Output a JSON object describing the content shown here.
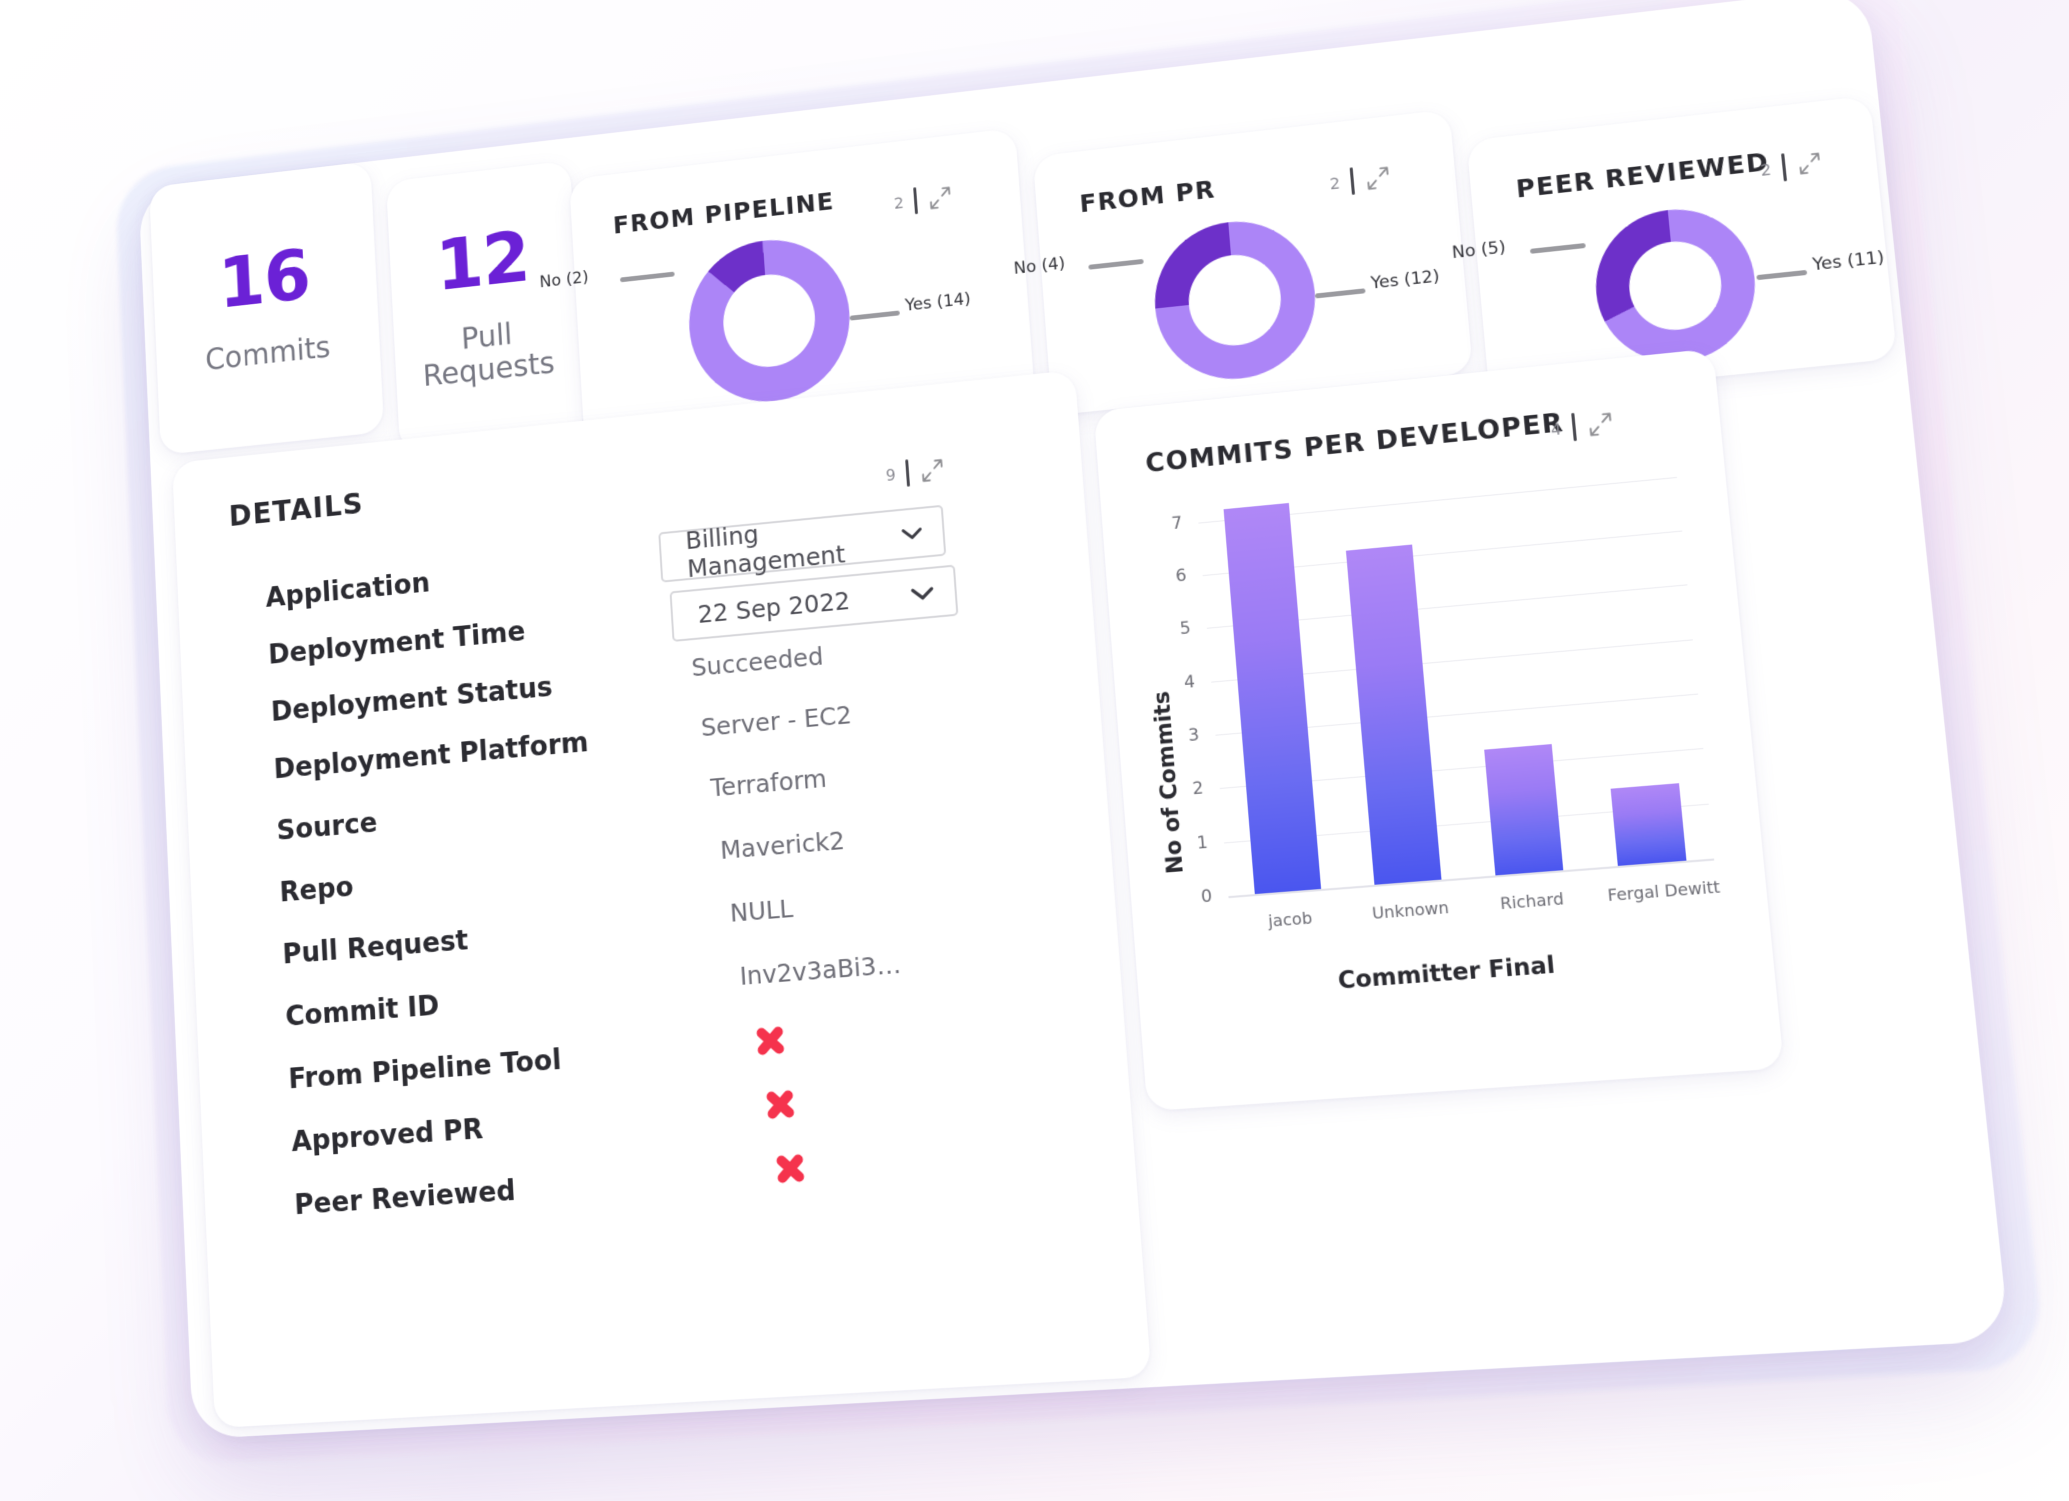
{
  "kpis": [
    {
      "name": "commits",
      "value": "16",
      "label": "Commits"
    },
    {
      "name": "pull-requests",
      "value": "12",
      "label": "Pull\nRequests"
    }
  ],
  "donut_cards": [
    {
      "id": "pipeline",
      "title": "FROM PIPELINE",
      "badge": "2",
      "chart_data": {
        "type": "pie",
        "title": "FROM PIPELINE",
        "categories": [
          "Yes",
          "No"
        ],
        "values": [
          14,
          2
        ],
        "labels": [
          "Yes (14)",
          "No (2)"
        ],
        "colors": [
          "#ac85f7",
          "#6d30c9"
        ],
        "legend": "callout-leader-lines"
      }
    },
    {
      "id": "pr",
      "title": "FROM PR",
      "badge": "2",
      "chart_data": {
        "type": "pie",
        "title": "FROM PR",
        "categories": [
          "Yes",
          "No"
        ],
        "values": [
          12,
          4
        ],
        "labels": [
          "Yes (12)",
          "No (4)"
        ],
        "colors": [
          "#ac85f7",
          "#6d30c9"
        ],
        "legend": "callout-leader-lines"
      }
    },
    {
      "id": "peer",
      "title": "PEER REVIEWED",
      "badge": "2",
      "chart_data": {
        "type": "pie",
        "title": "PEER REVIEWED",
        "categories": [
          "Yes",
          "No"
        ],
        "values": [
          11,
          5
        ],
        "labels": [
          "Yes (11)",
          "No (5)"
        ],
        "colors": [
          "#ac85f7",
          "#6d30c9"
        ],
        "legend": "callout-leader-lines"
      }
    }
  ],
  "details": {
    "title": "DETAILS",
    "badge": "9",
    "rows": [
      {
        "label": "Application",
        "value": "Billing Management",
        "kind": "dropdown"
      },
      {
        "label": "Deployment Time",
        "value": "22 Sep 2022",
        "kind": "dropdown"
      },
      {
        "label": "Deployment Status",
        "value": "Succeeded",
        "kind": "text"
      },
      {
        "label": "Deployment Platform",
        "value": "Server - EC2",
        "kind": "text"
      },
      {
        "label": "Source",
        "value": "Terraform",
        "kind": "text"
      },
      {
        "label": "Repo",
        "value": "Maverick2",
        "kind": "text"
      },
      {
        "label": "Pull Request",
        "value": "NULL",
        "kind": "text"
      },
      {
        "label": "Commit ID",
        "value": "Inv2v3aBi3…",
        "kind": "text"
      },
      {
        "label": "From Pipeline Tool",
        "value": "x-mark",
        "kind": "icon"
      },
      {
        "label": "Approved PR",
        "value": "x-mark",
        "kind": "icon"
      },
      {
        "label": "Peer Reviewed",
        "value": "x-mark",
        "kind": "icon"
      }
    ]
  },
  "bar_card": {
    "title": "COMMITS PER DEVELOPER",
    "badge": "4"
  },
  "chart_data": {
    "type": "bar",
    "title": "COMMITS PER DEVELOPER",
    "categories": [
      "jacob",
      "Unknown",
      "Richard",
      "Fergal Dewitt"
    ],
    "values": [
      7.2,
      6.2,
      2.3,
      1.4
    ],
    "xlabel": "Committer Final",
    "ylabel": "No of Commits",
    "yticks": [
      "0",
      "1",
      "2",
      "3",
      "4",
      "5",
      "6",
      "7"
    ],
    "ylim": [
      0,
      7.5
    ],
    "grid": true,
    "legend": "none"
  },
  "colors": {
    "accent": "#6B21D6",
    "donut_light": "#ac85f7",
    "donut_dark": "#6d30c9",
    "bar_top": "#b088f7",
    "bar_bottom": "#4a56ef",
    "danger": "#f5334d"
  }
}
